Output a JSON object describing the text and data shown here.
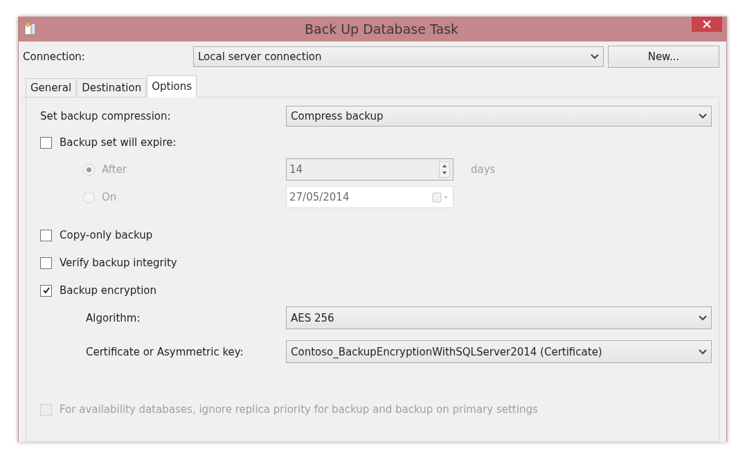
{
  "window": {
    "title": "Back Up Database Task"
  },
  "connection": {
    "label": "Connection:",
    "value": "Local server connection",
    "button": "New..."
  },
  "tabs": [
    {
      "label": "General",
      "selected": false
    },
    {
      "label": "Destination",
      "selected": false
    },
    {
      "label": "Options",
      "selected": true
    }
  ],
  "compression": {
    "label": "Set backup compression:",
    "value": "Compress backup"
  },
  "expire": {
    "label": "Backup set will expire:",
    "checked": false
  },
  "expire_options": [
    {
      "kind": "spinner",
      "label": "After",
      "selected": true,
      "disabled": true,
      "value": "14",
      "unit": "days"
    },
    {
      "kind": "date",
      "label": "On",
      "selected": false,
      "disabled": true,
      "value": "27/05/2014"
    }
  ],
  "options": [
    {
      "label": "Copy-only backup",
      "checked": false
    },
    {
      "label": "Verify backup integrity",
      "checked": false
    },
    {
      "label": "Backup encryption",
      "checked": true
    }
  ],
  "encryption": [
    {
      "label": "Algorithm:",
      "value": "AES 256"
    },
    {
      "label": "Certificate or Asymmetric key:",
      "value": "Contoso_BackupEncryptionWithSQLServer2014 (Certificate)"
    }
  ],
  "availability": {
    "label": "For availability databases, ignore replica priority for backup and backup on primary settings",
    "checked": false,
    "disabled": true
  }
}
